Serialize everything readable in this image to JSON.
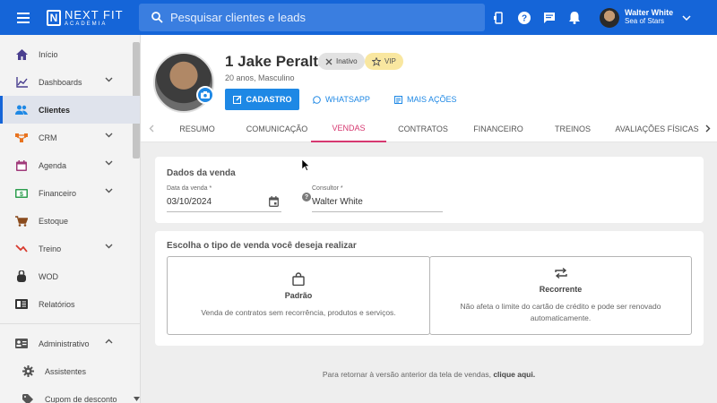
{
  "topbar": {
    "logo_main": "NEXT FIT",
    "logo_sub": "ACADEMIA",
    "search_placeholder": "Pesquisar clientes e leads",
    "user_name": "Walter White",
    "user_company": "Sea of Stars"
  },
  "sidebar": {
    "items": [
      {
        "label": "Início",
        "icon": "home-icon"
      },
      {
        "label": "Dashboards",
        "icon": "chart-icon"
      },
      {
        "label": "Clientes",
        "icon": "people-icon"
      },
      {
        "label": "CRM",
        "icon": "crm-icon"
      },
      {
        "label": "Agenda",
        "icon": "calendar-icon"
      },
      {
        "label": "Financeiro",
        "icon": "money-icon"
      },
      {
        "label": "Estoque",
        "icon": "cart-icon"
      },
      {
        "label": "Treino",
        "icon": "treino-icon"
      },
      {
        "label": "WOD",
        "icon": "kettlebell-icon"
      },
      {
        "label": "Relatórios",
        "icon": "report-icon"
      },
      {
        "label": "Administrativo",
        "icon": "admin-icon"
      },
      {
        "label": "Assistentes",
        "icon": "gear-icon"
      },
      {
        "label": "Cupom de desconto",
        "icon": "tag-icon"
      }
    ]
  },
  "profile": {
    "name": "1 Jake Peralta",
    "badge_inactive": "Inativo",
    "badge_vip": "VIP",
    "info": "20 anos, Masculino",
    "btn_cadastro": "CADASTRO",
    "btn_whatsapp": "WHATSAPP",
    "btn_mais": "MAIS AÇÕES"
  },
  "tabs": [
    "RESUMO",
    "COMUNICAÇÃO",
    "VENDAS",
    "CONTRATOS",
    "FINANCEIRO",
    "TREINOS",
    "AVALIAÇÕES FÍSICAS"
  ],
  "sale": {
    "title": "Dados da venda",
    "date_label": "Data da venda *",
    "date_value": "03/10/2024",
    "consultant_label": "Consultor *",
    "consultant_value": "Walter White"
  },
  "sale_type": {
    "title": "Escolha o tipo de venda você deseja realizar",
    "option1_title": "Padrão",
    "option1_desc": "Venda de contratos sem recorrência, produtos e serviços.",
    "option2_title": "Recorrente",
    "option2_desc_line1": "Não afeta o limite do cartão de crédito e pode ser renovado",
    "option2_desc_line2": "automaticamente."
  },
  "footer": {
    "text": "Para retornar à versão anterior da tela de vendas,",
    "link": "clique aqui."
  },
  "colors": {
    "primary": "#1565d8",
    "accent_tab": "#d63870",
    "button": "#1e88e5"
  }
}
